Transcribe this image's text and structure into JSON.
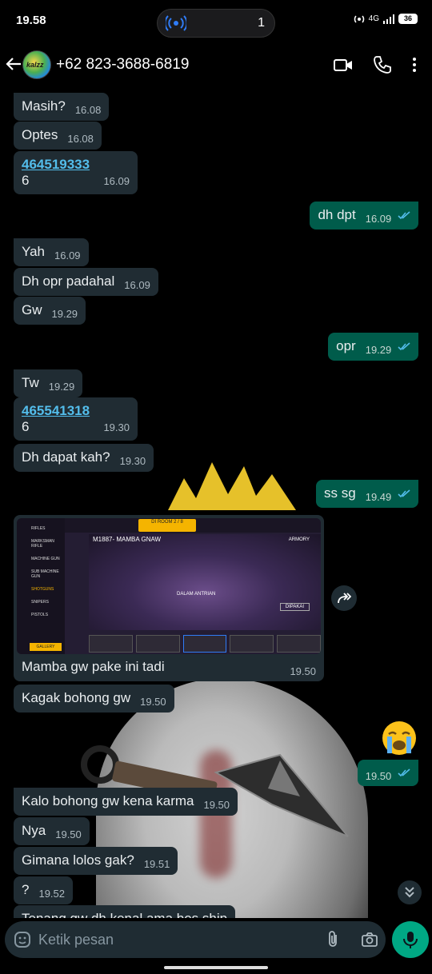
{
  "status_bar": {
    "time": "19.58",
    "notification_count": "1",
    "network": "4G",
    "battery": "36"
  },
  "header": {
    "contact_name": "+62 823-3688-6819",
    "avatar_text": "kalzz"
  },
  "messages": [
    {
      "dir": "in",
      "text": "Masih?",
      "time": "16.08"
    },
    {
      "dir": "in",
      "text": "Optes",
      "time": "16.08"
    },
    {
      "dir": "in",
      "link": "464519333",
      "text": "6",
      "time": "16.09"
    },
    {
      "dir": "out",
      "text": "dh dpt",
      "time": "16.09"
    },
    {
      "dir": "in",
      "text": "Yah",
      "time": "16.09"
    },
    {
      "dir": "in",
      "text": "Dh opr padahal",
      "time": "16.09"
    },
    {
      "dir": "in",
      "text": "Gw",
      "time": "19.29"
    },
    {
      "dir": "out",
      "text": "opr",
      "time": "19.29"
    },
    {
      "dir": "in",
      "text": "Tw",
      "time": "19.29"
    },
    {
      "dir": "in",
      "link": "465541318",
      "text": "6",
      "time": "19.30"
    },
    {
      "dir": "in",
      "text": "Dh dapat kah?",
      "time": "19.30"
    },
    {
      "dir": "out",
      "text": "ss sg",
      "time": "19.49"
    },
    {
      "dir": "in",
      "image": true,
      "text": "Mamba gw pake ini tadi",
      "time": "19.50"
    },
    {
      "dir": "in",
      "text": "Kagak bohong gw",
      "time": "19.50"
    },
    {
      "dir": "out",
      "emoji": "crying-face",
      "time": "19.50"
    },
    {
      "dir": "in",
      "text": "Kalo bohong gw kena karma",
      "time": "19.50"
    },
    {
      "dir": "in",
      "text": "Nya",
      "time": "19.50"
    },
    {
      "dir": "in",
      "text": "Gimana lolos gak?",
      "time": "19.51"
    },
    {
      "dir": "in",
      "text": "?",
      "time": "19.52"
    },
    {
      "dir": "in",
      "text": "Tenang gw dh kenal ama bos ship",
      "time": ""
    }
  ],
  "screenshot": {
    "gun_title": "M1887- MAMBA GNAW",
    "room": "DI ROOM 2 / 8",
    "armory": "ARMORY",
    "categories": [
      "RIFLES",
      "MARKSMAN RIFLE",
      "MACHINE GUN",
      "SUB MACHINE GUN",
      "SHOTGUNS",
      "SNIPERS",
      "PISTOLS"
    ],
    "gallery": "GALLERY",
    "in_queue": "DALAM ANTRIAN",
    "equip": "DIPAKAI"
  },
  "composer": {
    "placeholder": "Ketik pesan"
  },
  "colors": {
    "incoming": "#202c33",
    "outgoing": "#005c4b",
    "link": "#53bdeb",
    "accent": "#00a884",
    "read_tick": "#53bdeb"
  }
}
